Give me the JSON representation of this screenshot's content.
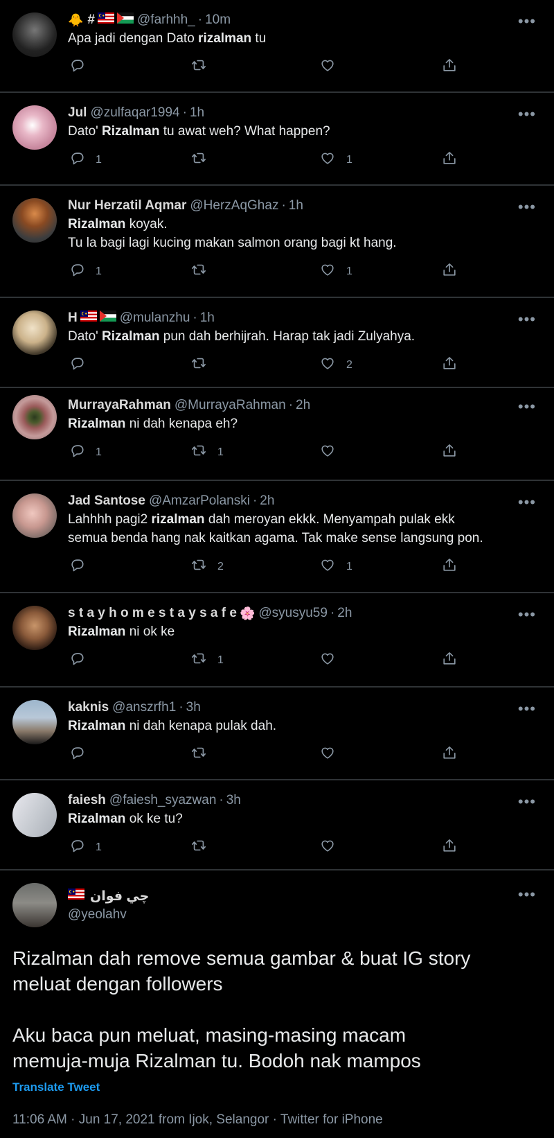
{
  "tweets": [
    {
      "name": "#",
      "pre_emoji": "🐥",
      "flags_after_name": [
        "my",
        "ps"
      ],
      "handle": "@farhhh_",
      "time": "10m",
      "text": [
        {
          "t": "Apa jadi dengan Dato "
        },
        {
          "b": "rizalman"
        },
        {
          "t": " tu"
        }
      ],
      "replies": "",
      "retweets": "",
      "likes": ""
    },
    {
      "name": "Jul",
      "handle": "@zulfaqar1994",
      "time": "1h",
      "text": [
        {
          "t": "Dato' "
        },
        {
          "b": "Rizalman"
        },
        {
          "t": " tu awat weh? What happen?"
        }
      ],
      "replies": "1",
      "retweets": "",
      "likes": "1"
    },
    {
      "name": "Nur Herzatil Aqmar",
      "handle": "@HerzAqGhaz",
      "time": "1h",
      "text": [
        {
          "b": "Rizalman"
        },
        {
          "t": " koyak.\nTu la bagi lagi kucing makan salmon orang bagi kt hang."
        }
      ],
      "replies": "1",
      "retweets": "",
      "likes": "1"
    },
    {
      "name": "H",
      "flags_after_name": [
        "my",
        "ps"
      ],
      "handle": "@mulanzhu",
      "time": "1h",
      "text": [
        {
          "t": "Dato' "
        },
        {
          "b": "Rizalman"
        },
        {
          "t": " pun dah berhijrah. Harap tak jadi Zulyahya."
        }
      ],
      "replies": "",
      "retweets": "",
      "likes": "2"
    },
    {
      "name": "MurrayaRahman",
      "handle": "@MurrayaRahman",
      "time": "2h",
      "text": [
        {
          "b": "Rizalman"
        },
        {
          "t": " ni dah kenapa eh?"
        }
      ],
      "replies": "1",
      "retweets": "1",
      "likes": ""
    },
    {
      "name": "Jad Santose",
      "handle": "@AmzarPolanski",
      "time": "2h",
      "text": [
        {
          "t": "Lahhhh pagi2 "
        },
        {
          "b": "rizalman"
        },
        {
          "t": " dah meroyan ekkk. Menyampah pulak ekk\nsemua benda hang nak kaitkan agama. Tak make sense langsung pon."
        }
      ],
      "replies": "",
      "retweets": "2",
      "likes": "1"
    },
    {
      "name": "s t a y h o m e s t a y s a f e",
      "post_emoji": "🌸",
      "handle": "@syusyu59",
      "time": "2h",
      "text": [
        {
          "b": "Rizalman"
        },
        {
          "t": " ni ok ke"
        }
      ],
      "replies": "",
      "retweets": "1",
      "likes": ""
    },
    {
      "name": "kaknis",
      "handle": "@anszrfh1",
      "time": "3h",
      "text": [
        {
          "b": "Rizalman"
        },
        {
          "t": " ni dah kenapa pulak dah."
        }
      ],
      "replies": "",
      "retweets": "",
      "likes": ""
    },
    {
      "name": "faiesh",
      "handle": "@faiesh_syazwan",
      "time": "3h",
      "text": [
        {
          "b": "Rizalman"
        },
        {
          "t": " ok ke tu?"
        }
      ],
      "replies": "1",
      "retweets": "",
      "likes": ""
    }
  ],
  "main_tweet": {
    "name": "چي فوان",
    "handle": "@yeolahv",
    "text": "Rizalman dah remove semua gambar & buat IG story\nmeluat dengan followers\n\nAku baca pun meluat, masing-masing macam\nmemuja-muja Rizalman tu. Bodoh nak mampos",
    "translate": "Translate Tweet",
    "meta": "11:06 AM · Jun 17, 2021 from Ijok, Selangor · Twitter for iPhone"
  },
  "colors": {
    "background": "#000000",
    "divider": "#2f3336",
    "muted": "#8b98a5",
    "link": "#1d9bf0"
  },
  "icons": [
    "reply-icon",
    "retweet-icon",
    "like-icon",
    "share-icon",
    "more-icon"
  ]
}
